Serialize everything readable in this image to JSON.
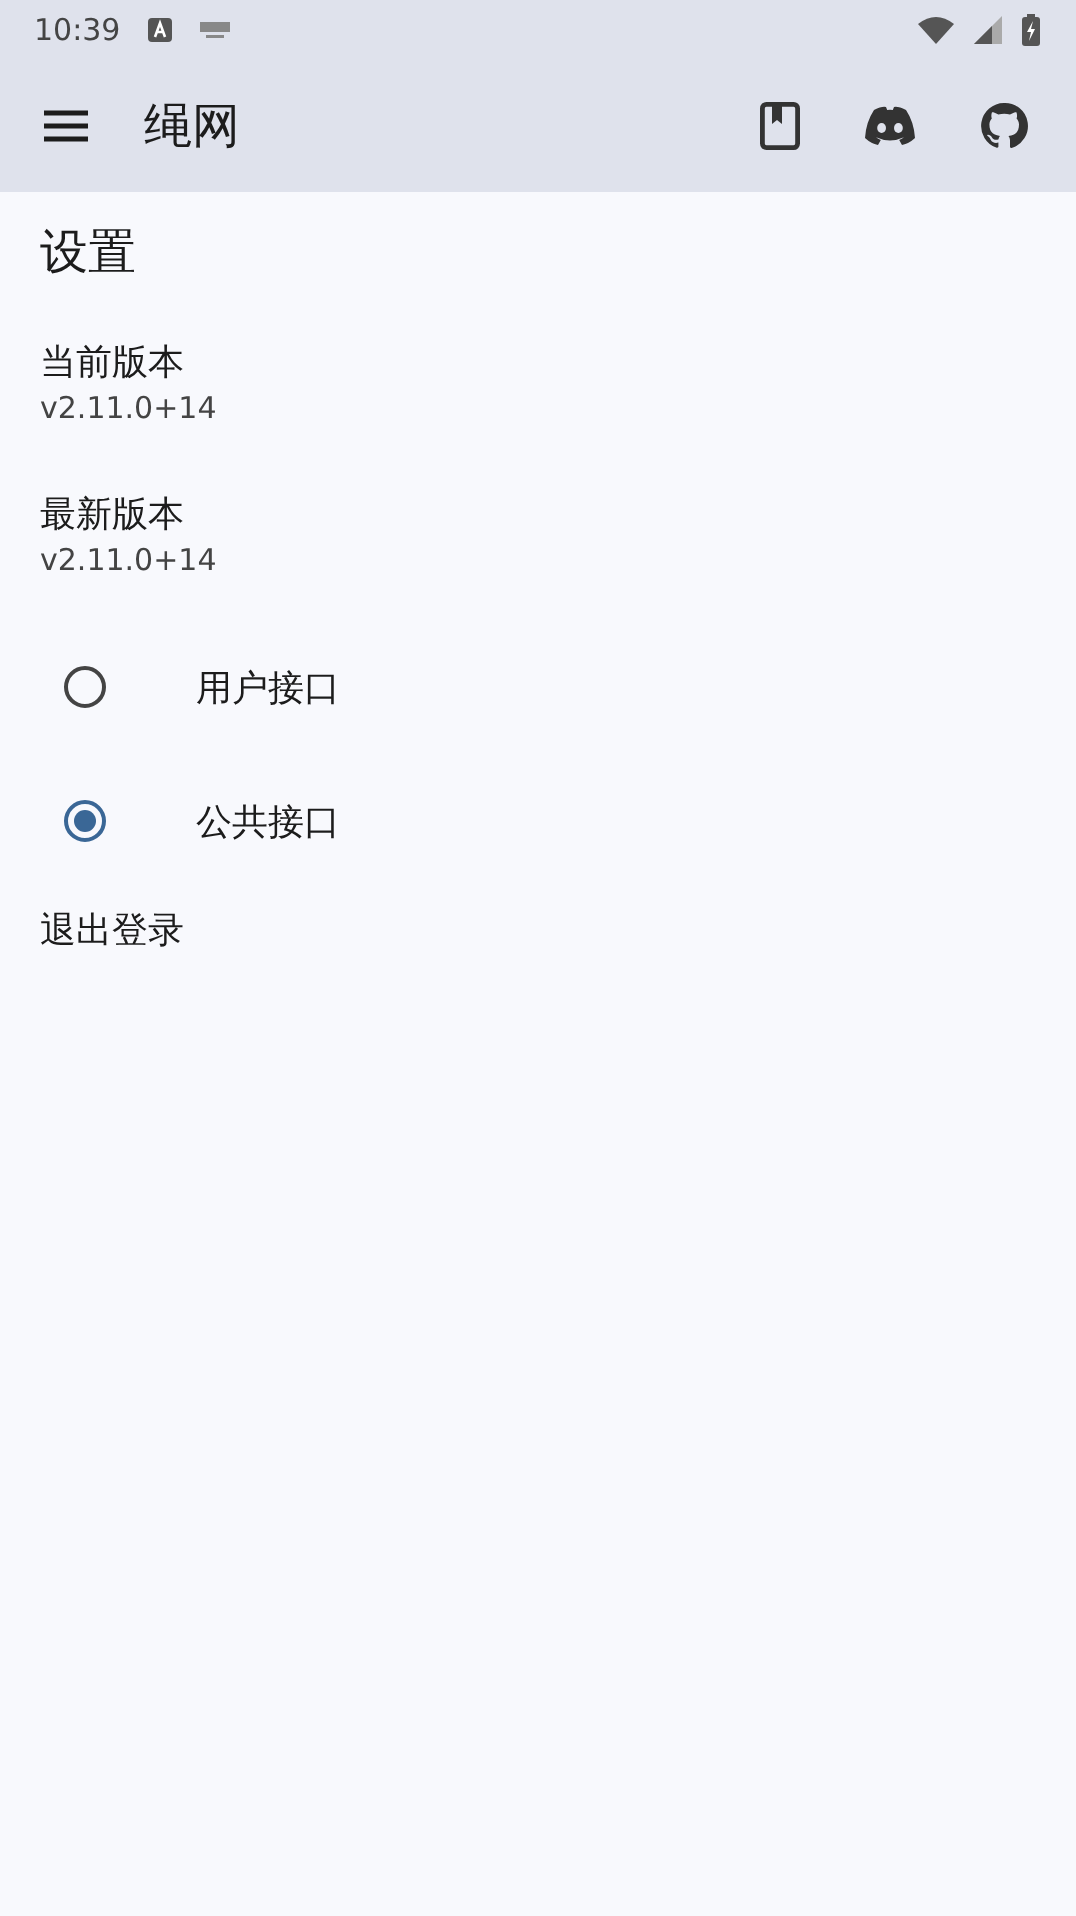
{
  "status_bar": {
    "time": "10:39"
  },
  "app_bar": {
    "title": "绳网"
  },
  "page": {
    "heading": "设置",
    "versions": [
      {
        "label": "当前版本",
        "value": "v2.11.0+14"
      },
      {
        "label": "最新版本",
        "value": "v2.11.0+14"
      }
    ],
    "api_options": [
      {
        "label": "用户接口",
        "selected": false
      },
      {
        "label": "公共接口",
        "selected": true
      }
    ],
    "logout": "退出登录"
  }
}
